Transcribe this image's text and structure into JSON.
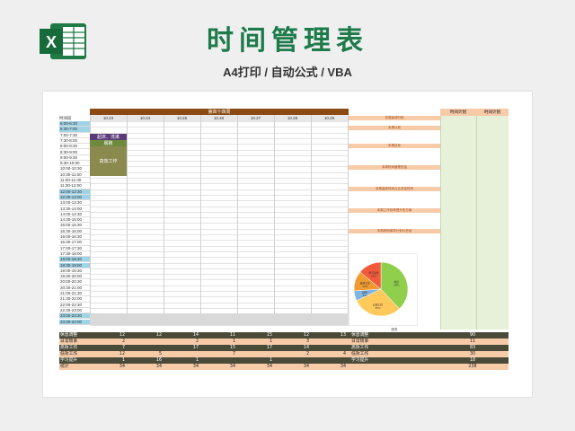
{
  "header": {
    "logo_letter": "X",
    "title": "时间管理表",
    "subtitle": "A4打印 / 自动公式 / VBA"
  },
  "sheet": {
    "week_title": "第四十四周",
    "time_col_header": "时间段",
    "plan_header": "时间计划",
    "actual_header": "时间计划",
    "dates": [
      "10.23",
      "10.24",
      "10.25",
      "10.26",
      "10.27",
      "10.28",
      "10.29"
    ],
    "times": [
      "6:00-6:30",
      "6:30-7:00",
      "7:00-7:30",
      "7:30-8:00",
      "8:00-8:30",
      "8:30-9:00",
      "9:00-9:30",
      "9:30-10:00",
      "10:00-10:30",
      "10:30-11:00",
      "11:00-11:30",
      "11:30-12:00",
      "12:00-12:30",
      "12:30-13:00",
      "13:00-13:30",
      "13:30-14:00",
      "14:00-14:30",
      "14:30-15:00",
      "15:00-15:30",
      "15:30-16:00",
      "16:00-16:30",
      "16:30-17:00",
      "17:00-17:30",
      "17:30-18:00",
      "18:00-18:30",
      "18:30-19:00",
      "19:00-19:30",
      "19:30-20:00",
      "20:00-20:30",
      "20:30-21:00",
      "21:00-21:30",
      "21:30-22:00",
      "22:00-22:30",
      "22:30-23:00",
      "23:00-23:30",
      "23:30-24:00"
    ],
    "tasks": [
      {
        "label": "起床、洗漱",
        "color": "#5b3a7a"
      },
      {
        "label": "晨跑",
        "color": "#6f8a3c"
      },
      {
        "label": "高效工作",
        "color": "#8a8a4e"
      }
    ],
    "side_boxes": [
      "本周高效时段",
      "本周计划",
      "本周目标",
      "本周时间管理总结",
      "本周高效时间占比总结时间",
      "本周工作效率提升的方案",
      "本周其他事项计划与总结"
    ],
    "chart_data": {
      "type": "pie",
      "categories": [
        "休息",
        "高效工作",
        "其他",
        "低效工作",
        "学习提升"
      ],
      "values": [
        38,
        30,
        6,
        12,
        14
      ],
      "slice_labels": [
        "休息\n38%",
        "高效工作\n30%",
        "其他\n6%",
        "低效工作\n12%",
        "学习提升\n14%"
      ],
      "colors": [
        "#8fcf4c",
        "#ffc95c",
        "#7fb3e0",
        "#f09a30",
        "#f15a3a"
      ],
      "legend_text": "图表"
    },
    "summary": {
      "rows": [
        {
          "label": "休息调整",
          "values": [
            "12",
            "12",
            "14",
            "11",
            "15",
            "12",
            "13"
          ],
          "label2": "休息调整",
          "total": "90",
          "style": "dark"
        },
        {
          "label": "日常琐事",
          "values": [
            "2",
            "",
            "2",
            "1",
            "1",
            "3",
            ""
          ],
          "label2": "日常琐事",
          "total": "11",
          "style": "light"
        },
        {
          "label": "高效工作",
          "values": [
            "7",
            "",
            "17",
            "15",
            "17",
            "14",
            ""
          ],
          "label2": "高效工作",
          "total": "83",
          "style": "dark"
        },
        {
          "label": "低效工作",
          "values": [
            "12",
            "5",
            "",
            "7",
            "",
            "2",
            "4"
          ],
          "label2": "低效工作",
          "total": "30",
          "style": "light"
        },
        {
          "label": "学习提升",
          "values": [
            "1",
            "16",
            "1",
            "",
            "1",
            "",
            ""
          ],
          "label2": "学习提升",
          "total": "18",
          "style": "dark"
        },
        {
          "label": "统计",
          "values": [
            "34",
            "34",
            "34",
            "34",
            "34",
            "34",
            "34"
          ],
          "label2": "",
          "total": "238",
          "style": "light"
        }
      ]
    }
  }
}
